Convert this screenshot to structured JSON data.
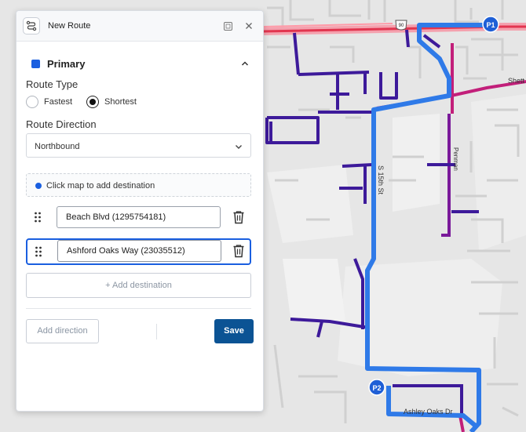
{
  "panel": {
    "title": "New Route",
    "route_icon": "route-icon",
    "dock_icon": "dock-icon",
    "close_icon": "close-icon",
    "section_title": "Primary",
    "section_color": "#1a5fe0",
    "route_type_label": "Route Type",
    "route_type_options": [
      {
        "label": "Fastest",
        "selected": false
      },
      {
        "label": "Shortest",
        "selected": true
      }
    ],
    "route_direction_label": "Route Direction",
    "route_direction_value": "Northbound",
    "hint": "Click map to add destination",
    "destinations": [
      {
        "value": "Beach Blvd (1295754181)"
      },
      {
        "value": "Ashford Oaks Way (23035512)"
      }
    ],
    "add_destination": "+ Add destination",
    "add_direction": "Add direction",
    "save": "Save"
  },
  "map": {
    "markers": [
      "P1",
      "P2"
    ],
    "labels": {
      "highway_shield": "90",
      "shetter": "Shett",
      "s15th": "S 15th St",
      "penman": "Penman",
      "ashley": "Ashley Oaks Dr"
    },
    "colors": {
      "route": "#2f7ae8",
      "road_purple": "#3d1a9a",
      "road_magenta": "#c21f7a",
      "highway_red": "#e2354f"
    }
  }
}
